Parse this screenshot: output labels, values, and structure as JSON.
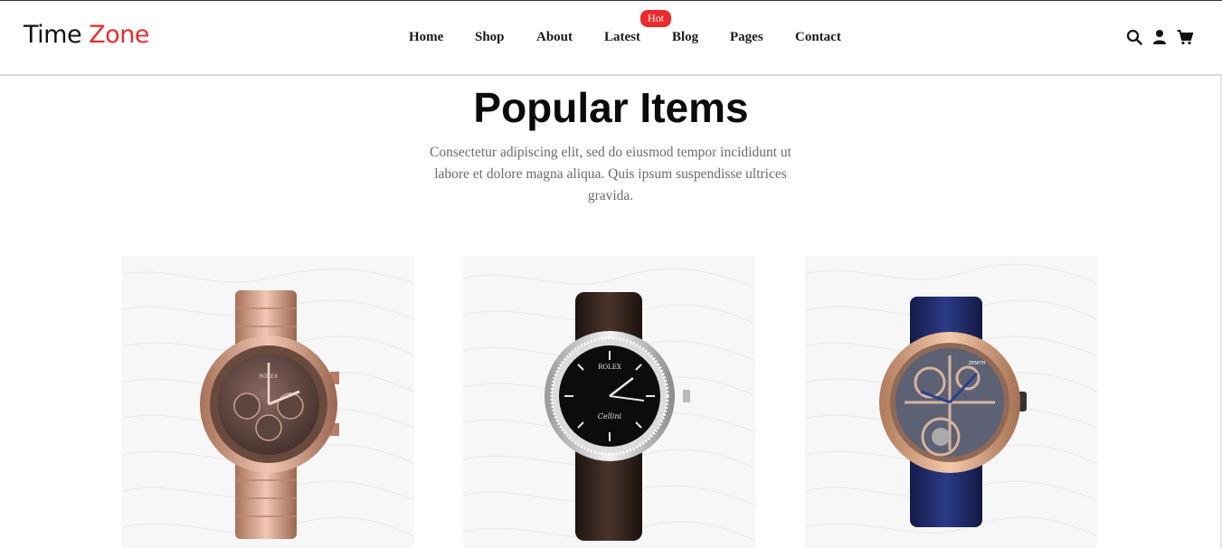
{
  "header": {
    "logo": {
      "part1": "Time",
      "part2": "Zone"
    },
    "nav": [
      {
        "label": "Home"
      },
      {
        "label": "Shop"
      },
      {
        "label": "About"
      },
      {
        "label": "Latest"
      },
      {
        "label": "Blog"
      },
      {
        "label": "Pages"
      },
      {
        "label": "Contact"
      }
    ],
    "hot_badge": "Hot",
    "icons": [
      "search-icon",
      "user-icon",
      "cart-icon"
    ]
  },
  "section": {
    "title": "Popular Items",
    "subtitle": "Consectetur adipiscing elit, sed do eiusmod tempor incididunt ut labore et dolore magna aliqua. Quis ipsum suspendisse ultrices gravida."
  },
  "products": [
    {
      "image": "rose-gold-chronograph-watch",
      "dial_text": "ROLEX"
    },
    {
      "image": "black-dial-leather-strap-watch",
      "dial_text": "ROLEX",
      "dial_script": "Cellini"
    },
    {
      "image": "skeleton-tourbillon-blue-strap-watch",
      "dial_text": "ZENITH"
    }
  ],
  "colors": {
    "accent": "#ec2c2c",
    "text": "#111111",
    "muted": "#6b6b6b"
  }
}
